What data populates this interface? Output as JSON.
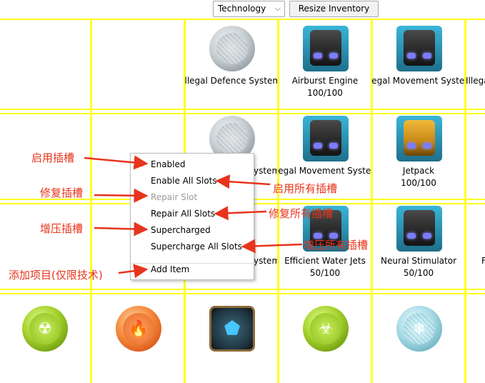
{
  "toolbar": {
    "category_select": "Technology",
    "resize_button": "Resize Inventory"
  },
  "grid": {
    "row1": [
      {
        "name": "",
        "qty": ""
      },
      {
        "name": "",
        "qty": ""
      },
      {
        "name": "Illegal Defence System",
        "qty": ""
      },
      {
        "name": "Airburst Engine",
        "qty": "100/100"
      },
      {
        "name": "Illegal Movement System",
        "qty": ""
      },
      {
        "name": "Illegal",
        "qty": ""
      }
    ],
    "row2": [
      {
        "name": "",
        "qty": ""
      },
      {
        "name": "ystem",
        "qty": ""
      },
      {
        "name": "Illegal Movement System",
        "qty": ""
      },
      {
        "name": "Jetpack",
        "qty": "100/100"
      }
    ],
    "row3": [
      {
        "name": "ystem",
        "qty": ""
      },
      {
        "name": "Efficient Water Jets",
        "qty": "50/100"
      },
      {
        "name": "Neural Stimulator",
        "qty": "50/100"
      },
      {
        "name": "F",
        "qty": ""
      }
    ]
  },
  "context_menu": {
    "items": [
      {
        "label": "Enabled",
        "checked": true,
        "enabled": true
      },
      {
        "label": "Enable All Slots",
        "checked": false,
        "enabled": true
      },
      {
        "label": "Repair Slot",
        "checked": false,
        "enabled": false
      },
      {
        "label": "Repair All Slots",
        "checked": false,
        "enabled": true
      },
      {
        "label": "Supercharged",
        "checked": false,
        "enabled": true
      },
      {
        "label": "Supercharge All Slots",
        "checked": false,
        "enabled": true
      },
      {
        "label": "Add Item",
        "checked": false,
        "enabled": true
      }
    ]
  },
  "annotations": {
    "enable_slot": "启用插槽",
    "repair_slot": "修复插槽",
    "supercharge_slot": "增压插槽",
    "add_item": "添加项目(仅限技术)",
    "enable_all": "启用所有插槽",
    "repair_all": "修复所有插槽",
    "supercharge_all": "增压所有插槽"
  },
  "colors": {
    "grid_line": "#ffff20",
    "annotation": "#e8341c"
  }
}
